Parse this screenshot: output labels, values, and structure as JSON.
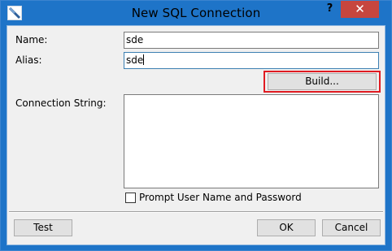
{
  "window": {
    "title": "New SQL Connection",
    "help_label": "?",
    "close_label": "✕"
  },
  "form": {
    "name_label": "Name:",
    "name_value": "sde",
    "alias_label": "Alias:",
    "alias_value": "sde",
    "build_label": "Build...",
    "connection_string_label": "Connection String:",
    "connection_string_value": "",
    "prompt_label": "Prompt User Name and Password",
    "prompt_checked": false
  },
  "footer": {
    "test_label": "Test",
    "ok_label": "OK",
    "cancel_label": "Cancel"
  },
  "colors": {
    "title_bar": "#1e74c8",
    "close_button": "#c7463e",
    "highlight": "#e01b22",
    "dialog_body": "#f0f0f0"
  }
}
